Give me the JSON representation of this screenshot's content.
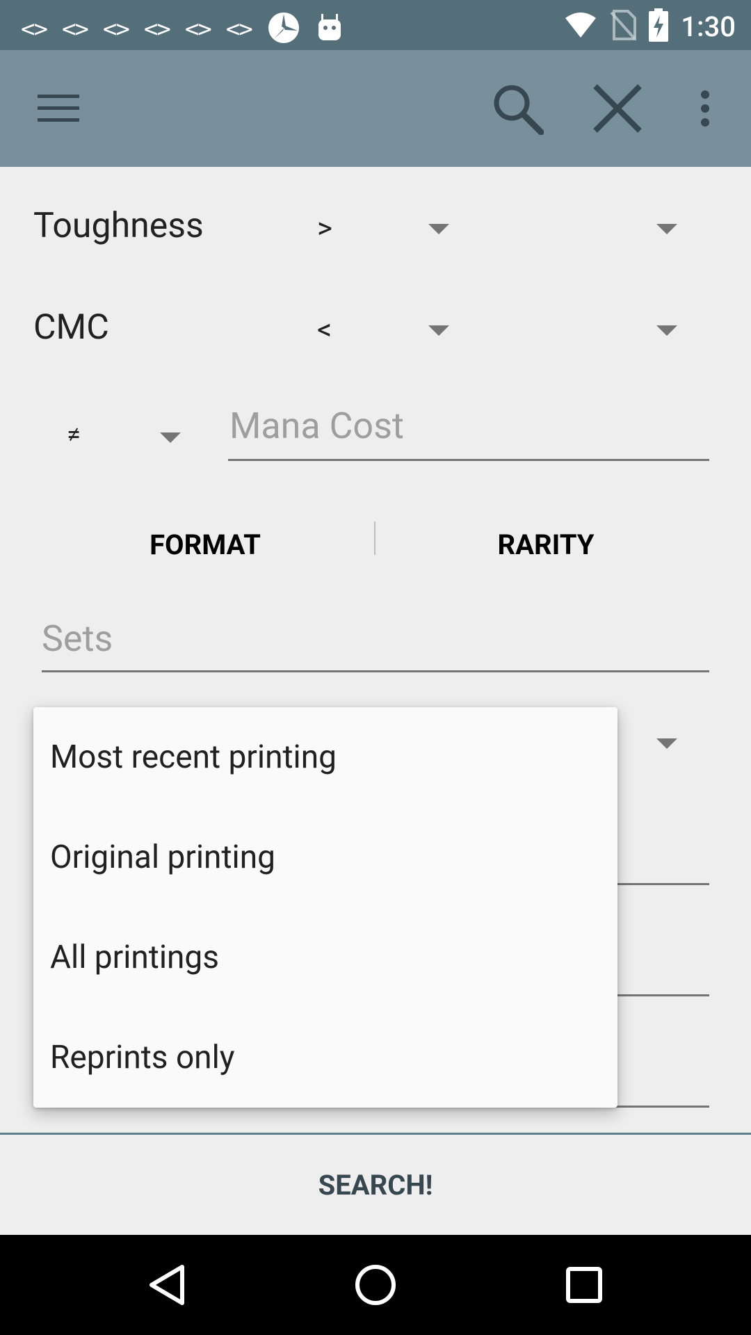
{
  "status_bar": {
    "notification_icons": [
      "code-icon",
      "code-icon",
      "code-icon",
      "code-icon",
      "code-icon",
      "code-icon",
      "snowflake-app-icon",
      "android-icon"
    ],
    "code_glyph": "<>",
    "time": "1:30",
    "status_icons": [
      "wifi-icon",
      "no-sim-icon",
      "battery-charging-icon"
    ]
  },
  "toolbar": {
    "icons": [
      "menu-icon",
      "search-icon",
      "close-icon",
      "overflow-menu-icon"
    ]
  },
  "form": {
    "toughness": {
      "label": "Toughness",
      "comparator": ">"
    },
    "cmc": {
      "label": "CMC",
      "comparator": "<"
    },
    "mana_cost": {
      "comparator": "≠",
      "placeholder": "Mana Cost"
    },
    "format_button": "FORMAT",
    "rarity_button": "RARITY",
    "sets_placeholder": "Sets"
  },
  "dropdown_menu": {
    "items": [
      "Most recent printing",
      "Original printing",
      "All printings",
      "Reprints only"
    ]
  },
  "search_button": "SEARCH!",
  "colors": {
    "status_bar": "#546e7a",
    "toolbar": "#78909c",
    "background": "#eeeeee",
    "accent_line": "#607d8b"
  }
}
